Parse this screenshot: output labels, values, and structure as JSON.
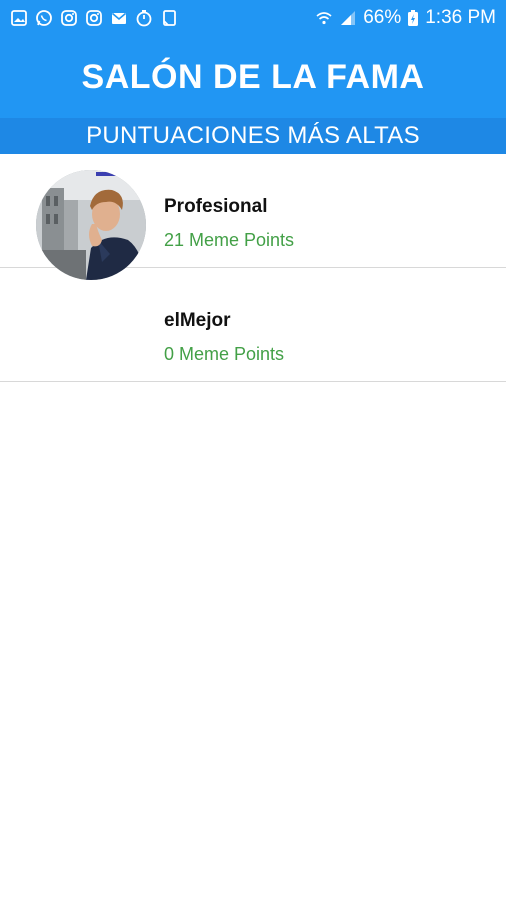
{
  "status_bar": {
    "left_icons": [
      "image-icon",
      "whatsapp-icon",
      "instagram-icon",
      "instagram-icon",
      "mail-icon",
      "timer-icon",
      "clipboard-icon"
    ],
    "battery_percent": "66%",
    "time": "1:36 PM"
  },
  "header": {
    "title": "SALÓN DE LA FAMA",
    "subtitle": "PUNTUACIONES MÁS ALTAS"
  },
  "leaderboard": [
    {
      "name": "Profesional",
      "points": "21 Meme Points",
      "has_avatar": true
    },
    {
      "name": "elMejor",
      "points": "0 Meme Points",
      "has_avatar": false
    }
  ],
  "colors": {
    "app_bar": "#2196F3",
    "sub_bar": "#1E88E5",
    "points_green": "#43A047"
  }
}
